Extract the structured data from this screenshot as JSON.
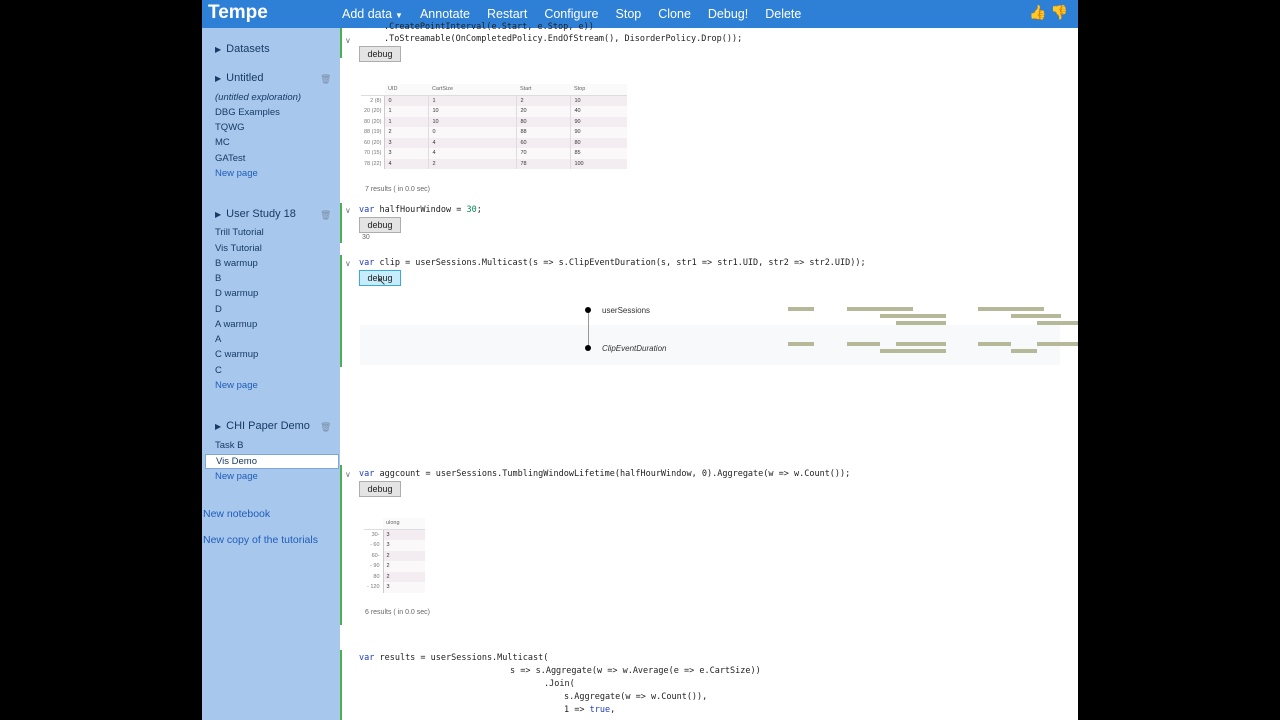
{
  "app": {
    "brand": "Tempe"
  },
  "menu": [
    {
      "label": "Add data",
      "caret": true
    },
    {
      "label": "Annotate"
    },
    {
      "label": "Restart"
    },
    {
      "label": "Configure"
    },
    {
      "label": "Stop"
    },
    {
      "label": "Clone"
    },
    {
      "label": "Debug!"
    },
    {
      "label": "Delete"
    }
  ],
  "thumbs": {
    "up": "👍",
    "down": "👎"
  },
  "sidebar": {
    "datasets": "Datasets",
    "untitled": {
      "title": "Untitled",
      "items": [
        "(untitled exploration)",
        "DBG Examples",
        "TQWG",
        "MC",
        "GATest"
      ],
      "new_page": "New page"
    },
    "user_study": {
      "title": "User Study 18",
      "items": [
        "Trill Tutorial",
        "Vis Tutorial",
        "B warmup",
        "B",
        "D warmup",
        "D",
        "A warmup",
        "A",
        "C warmup",
        "C"
      ],
      "new_page": "New page"
    },
    "chi": {
      "title": "CHI Paper Demo",
      "items": [
        "Task B",
        "Vis Demo"
      ],
      "selected": "Vis Demo",
      "new_page": "New page"
    },
    "new_notebook": "New notebook",
    "new_copy": "New copy of the tutorials"
  },
  "cells": {
    "c1": {
      "line0": ".CreatePointInterval(e.Start, e.Stop, e))",
      "line1": ".ToStreamable(OnCompletedPolicy.EndOfStream(), DisorderPolicy.Drop());",
      "debug": "debug",
      "table": {
        "headers": [
          "UID",
          "CartSize",
          "Start",
          "Stop"
        ],
        "rows": [
          {
            "label": "2 (8)",
            "cells": [
              "0",
              "1",
              "2",
              "10"
            ]
          },
          {
            "label": "20 (20)",
            "cells": [
              "1",
              "10",
              "20",
              "40"
            ]
          },
          {
            "label": "80 (20)",
            "cells": [
              "1",
              "10",
              "80",
              "90"
            ]
          },
          {
            "label": "88 (19)",
            "cells": [
              "2",
              "0",
              "88",
              "90"
            ]
          },
          {
            "label": "60 (20)",
            "cells": [
              "3",
              "4",
              "60",
              "80"
            ]
          },
          {
            "label": "70 (15)",
            "cells": [
              "3",
              "4",
              "70",
              "85"
            ]
          },
          {
            "label": "78 (22)",
            "cells": [
              "4",
              "2",
              "78",
              "100"
            ]
          }
        ]
      },
      "results": "7 results ( in 0.0 sec)"
    },
    "c2": {
      "kw": "var",
      "rest": " halfHourWindow = ",
      "num": "30",
      "end": ";",
      "debug": "debug",
      "output": "30"
    },
    "c3": {
      "kw": "var",
      "rest": " clip = userSessions.Multicast(s => s.ClipEventDuration(s, str1 => str1.UID, str2 => str2.UID));",
      "debug": "debug",
      "series": [
        "userSessions",
        "ClipEventDuration"
      ]
    },
    "c4": {
      "kw": "var",
      "rest": " aggcount = userSessions.TumblingWindowLifetime(halfHourWindow, 0).Aggregate(w => w.Count());",
      "debug": "debug",
      "table": {
        "headers": [
          "ulong"
        ],
        "rows": [
          {
            "label": "30-",
            "cells": [
              "3"
            ]
          },
          {
            "label": "- 60",
            "cells": [
              "3"
            ]
          },
          {
            "label": "60-",
            "cells": [
              "2"
            ]
          },
          {
            "label": "- 90",
            "cells": [
              "2"
            ]
          },
          {
            "label": "80",
            "cells": [
              "2"
            ]
          },
          {
            "label": "- 120",
            "cells": [
              "3"
            ]
          }
        ]
      },
      "results": "6 results ( in 0.0 sec)"
    },
    "c5": {
      "kw": "var",
      "l1": " results = userSessions.Multicast(",
      "l2": "s => s.Aggregate(w => w.Average(e => e.CartSize))",
      "l3": ".Join(",
      "l4": "s.Aggregate(w => w.Count()),",
      "l5a": "1 => ",
      "l5kw": "true",
      "l5b": ","
    }
  },
  "colors": {
    "topbar": "#2e7fd6",
    "sidebar": "#a7c7ec",
    "interval": "#b5b99a"
  }
}
